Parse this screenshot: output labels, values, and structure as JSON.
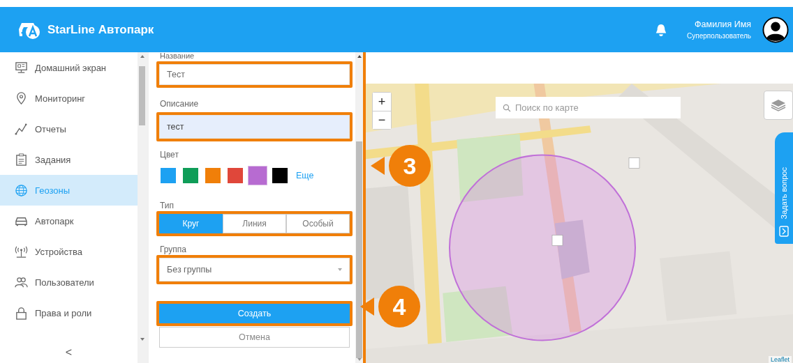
{
  "header": {
    "app_title": "StarLine Автопарк",
    "user_name": "Фамилия Имя",
    "user_role": "Суперпользователь"
  },
  "sidebar": {
    "items": [
      {
        "label": "Домашний экран",
        "selected": false
      },
      {
        "label": "Мониторинг",
        "selected": false
      },
      {
        "label": "Отчеты",
        "selected": false
      },
      {
        "label": "Задания",
        "selected": false
      },
      {
        "label": "Геозоны",
        "selected": true
      },
      {
        "label": "Автопарк",
        "selected": false
      },
      {
        "label": "Устройства",
        "selected": false
      },
      {
        "label": "Пользователи",
        "selected": false
      },
      {
        "label": "Права и роли",
        "selected": false
      }
    ],
    "collapse": "<"
  },
  "form": {
    "fields": [
      {
        "label": "Название",
        "value": "Тест",
        "focused": false,
        "highlighted": true
      },
      {
        "label": "Описание",
        "value": "тест",
        "focused": true,
        "highlighted": true
      }
    ],
    "color": {
      "label": "Цвет",
      "more_link": "Еще",
      "swatches": [
        {
          "color": "#1da1f2",
          "selected": false
        },
        {
          "color": "#0f9d58",
          "selected": false
        },
        {
          "color": "#f07f09",
          "selected": false
        },
        {
          "color": "#e0473a",
          "selected": false
        },
        {
          "color": "#b76bd1",
          "selected": true
        },
        {
          "color": "#000000",
          "selected": false
        }
      ]
    },
    "type": {
      "label": "Тип",
      "highlighted": true,
      "options": [
        {
          "label": "Круг",
          "selected": true
        },
        {
          "label": "Линия",
          "selected": false
        },
        {
          "label": "Особый",
          "selected": false
        }
      ]
    },
    "group": {
      "label": "Группа",
      "value": "Без группы",
      "highlighted": true
    },
    "buttons": [
      {
        "label": "Создать",
        "kind": "primary",
        "highlighted": true
      },
      {
        "label": "Отмена",
        "kind": "secondary",
        "highlighted": false
      }
    ]
  },
  "map": {
    "zoom_in": "+",
    "zoom_out": "−",
    "search_placeholder": "Поиск по карте",
    "feedback_tab": "Задать вопрос",
    "attribution": "Leaflet"
  },
  "callouts": [
    {
      "number": "3"
    },
    {
      "number": "4"
    }
  ]
}
